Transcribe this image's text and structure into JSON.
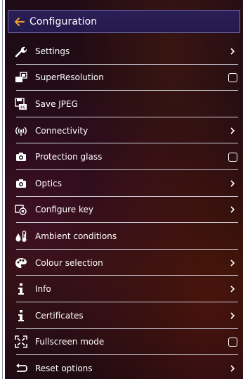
{
  "header": {
    "title": "Configuration"
  },
  "menu": {
    "items": [
      {
        "label": "Settings",
        "icon": "wrench-icon",
        "control": "chevron"
      },
      {
        "label": "SuperResolution",
        "icon": "superresolution-icon",
        "control": "checkbox",
        "checked": false
      },
      {
        "label": "Save JPEG",
        "icon": "save-jpeg-icon",
        "control": "none"
      },
      {
        "label": "Connectivity",
        "icon": "wireless-icon",
        "control": "chevron"
      },
      {
        "label": "Protection glass",
        "icon": "camera-icon",
        "control": "checkbox",
        "checked": false
      },
      {
        "label": "Optics",
        "icon": "camera-icon",
        "control": "chevron"
      },
      {
        "label": "Configure key",
        "icon": "configure-key-icon",
        "control": "chevron"
      },
      {
        "label": "Ambient conditions",
        "icon": "ambient-conditions-icon",
        "control": "none"
      },
      {
        "label": "Colour selection",
        "icon": "palette-icon",
        "control": "chevron"
      },
      {
        "label": "Info",
        "icon": "info-icon",
        "control": "chevron"
      },
      {
        "label": "Certificates",
        "icon": "info-icon",
        "control": "chevron"
      },
      {
        "label": "Fullscreen mode",
        "icon": "fullscreen-icon",
        "control": "checkbox",
        "checked": false
      },
      {
        "label": "Reset options",
        "icon": "reset-icon",
        "control": "chevron"
      }
    ]
  },
  "colors": {
    "header_bg": "#2b1f57",
    "header_border": "#6f6aa7",
    "text": "#ffffff",
    "divider": "#cfcfd8"
  }
}
